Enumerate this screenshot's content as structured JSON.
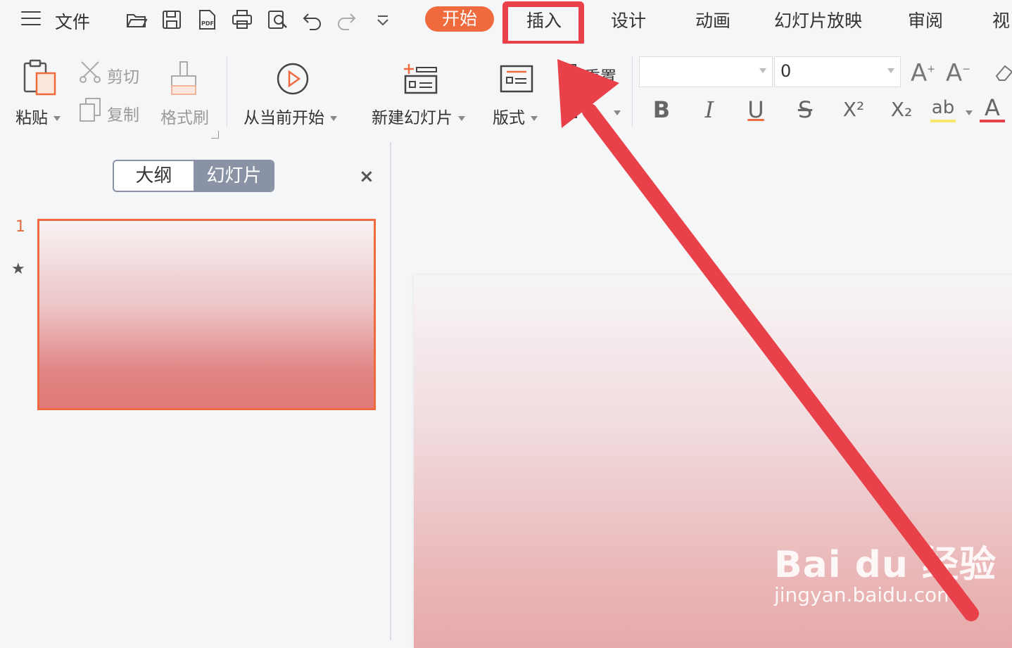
{
  "menubar": {
    "file_label": "文件",
    "quick_access": [
      "open-folder-icon",
      "save-icon",
      "export-pdf-icon",
      "print-icon",
      "print-preview-icon",
      "undo-icon",
      "redo-icon",
      "customize-dropdown-icon"
    ],
    "pdf_text": "PDF",
    "tabs": [
      {
        "label": "开始",
        "active": true
      },
      {
        "label": "插入",
        "highlighted": true
      },
      {
        "label": "设计"
      },
      {
        "label": "动画"
      },
      {
        "label": "幻灯片放映"
      },
      {
        "label": "审阅"
      },
      {
        "label": "视"
      }
    ],
    "accent_color": "#ef6a3c",
    "highlight_color": "#e8414a"
  },
  "ribbon": {
    "paste_label": "粘贴",
    "cut_label": "剪切",
    "copy_label": "复制",
    "format_painter_label": "格式刷",
    "from_current_label": "从当前开始",
    "new_slide_label": "新建幻灯片",
    "layout_label": "版式",
    "reset_label": "重置",
    "font_name_value": "",
    "font_size_value": "0",
    "format_buttons": [
      "B",
      "I",
      "U",
      "S",
      "X²",
      "X₂",
      "ab",
      "A"
    ]
  },
  "panel": {
    "outline_tab": "大纲",
    "slides_tab": "幻灯片",
    "close_symbol": "×",
    "slide_number": "1",
    "star_symbol": "★"
  },
  "watermark": {
    "logo_text": "Bai du 经验",
    "url_text": "jingyan.baidu.com"
  }
}
